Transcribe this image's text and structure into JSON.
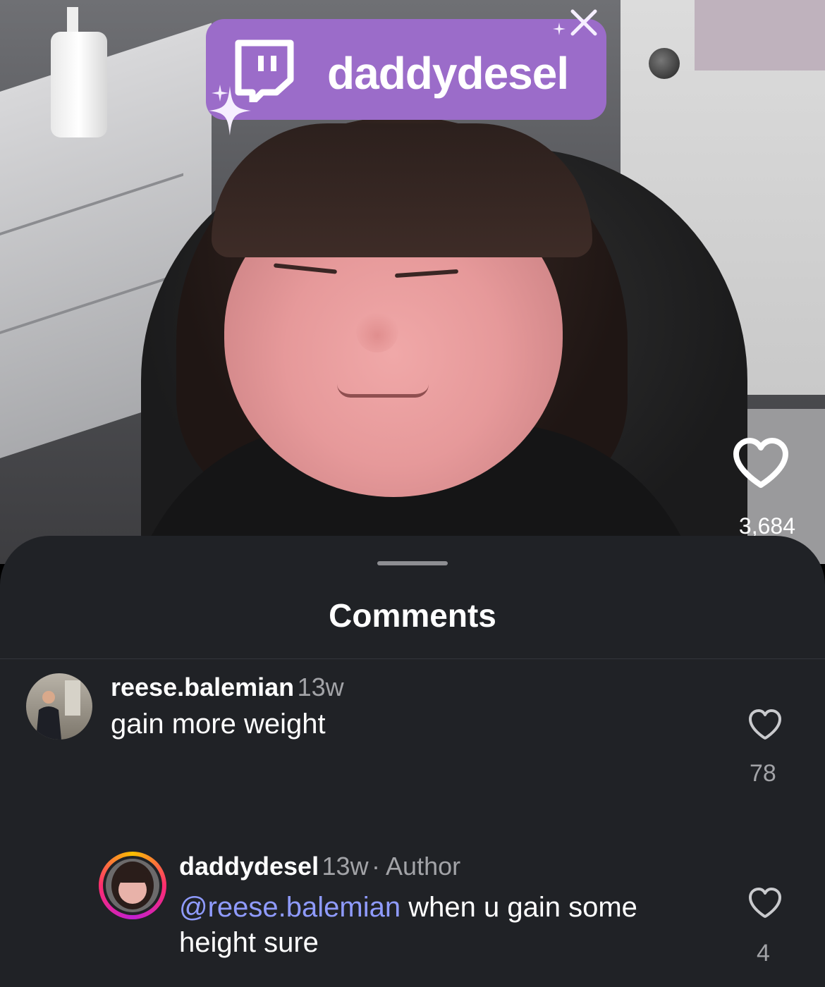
{
  "overlay": {
    "badge_name": "daddydesel",
    "like_count": "3,684"
  },
  "sheet": {
    "title": "Comments"
  },
  "comments": [
    {
      "username": "reese.balemian",
      "time": "13w",
      "text": "gain more weight",
      "likes": "78"
    },
    {
      "username": "daddydesel",
      "time": "13w",
      "author_label": "· Author",
      "mention": "@reese.balemian",
      "text_line1": "when u gain some",
      "text_line2": "height sure",
      "likes": "4"
    }
  ],
  "colors": {
    "sheet_bg": "#202226",
    "twitch_purple": "#9b6cc9",
    "mention": "#8f9bff",
    "meta_gray": "#a2a3a7"
  },
  "icons": [
    "twitch-icon",
    "heart-icon",
    "sparkle-icon"
  ]
}
